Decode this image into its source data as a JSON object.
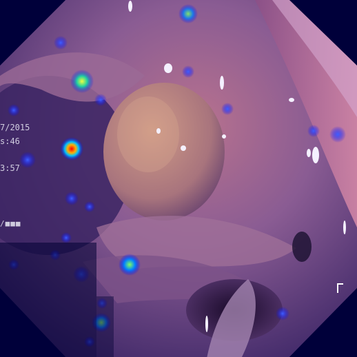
{
  "osd": {
    "date": "7/2015",
    "time_a": "s:46",
    "time_b": "3:57",
    "bar": "/■■■"
  },
  "colors": {
    "background": "#00003a",
    "mucosa_light": "#d58fb0",
    "mucosa_dark": "#5a2e6e",
    "polyp": "#c78a86",
    "lumen": "#140a2e"
  },
  "heatmap_spots": [
    {
      "name": "hot-spot-red",
      "level": 1.0
    },
    {
      "name": "hot-spot-yellow",
      "level": 0.75
    },
    {
      "name": "hot-spot-green",
      "level": 0.55
    }
  ]
}
